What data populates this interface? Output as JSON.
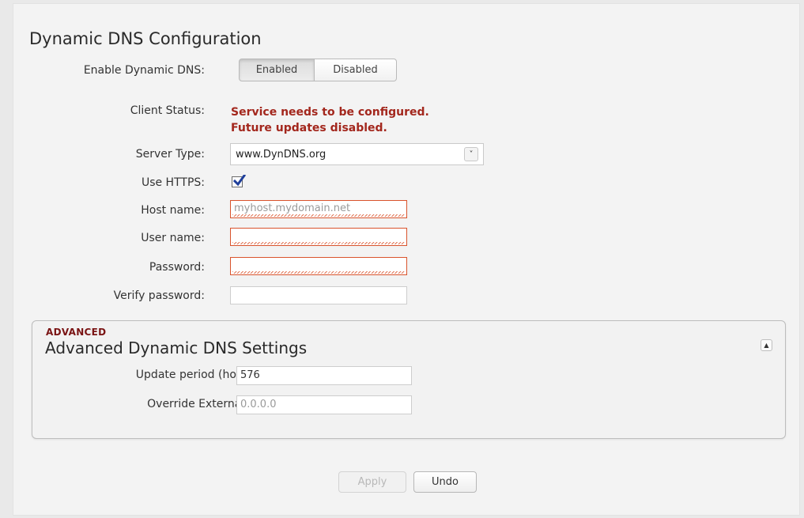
{
  "page_title": "Dynamic DNS Configuration",
  "enable": {
    "label": "Enable Dynamic DNS:",
    "options": [
      "Enabled",
      "Disabled"
    ],
    "selected": "Enabled"
  },
  "client_status": {
    "label": "Client Status:",
    "line1": "Service needs to be configured.",
    "line2": "Future updates disabled."
  },
  "server_type": {
    "label": "Server Type:",
    "value": "www.DynDNS.org",
    "arrow": "˅"
  },
  "use_https": {
    "label": "Use HTTPS:",
    "checked": true
  },
  "host_name": {
    "label": "Host name:",
    "value": "",
    "placeholder": "myhost.mydomain.net"
  },
  "user_name": {
    "label": "User name:",
    "value": ""
  },
  "password": {
    "label": "Password:",
    "value": ""
  },
  "verify_password": {
    "label": "Verify password:",
    "value": ""
  },
  "advanced": {
    "tag": "ADVANCED",
    "title": "Advanced Dynamic DNS Settings",
    "collapse_icon": "▲",
    "update_period": {
      "label": "Update period (hours):",
      "value": "576"
    },
    "override_ip": {
      "label": "Override External IP:",
      "value": "",
      "placeholder": "0.0.0.0"
    }
  },
  "buttons": {
    "apply": "Apply",
    "undo": "Undo"
  },
  "colors": {
    "status_error": "#a3271d",
    "field_error_border": "#d9532c",
    "advanced_tag": "#7a1414",
    "checkbox_check": "#1f3f9a"
  }
}
